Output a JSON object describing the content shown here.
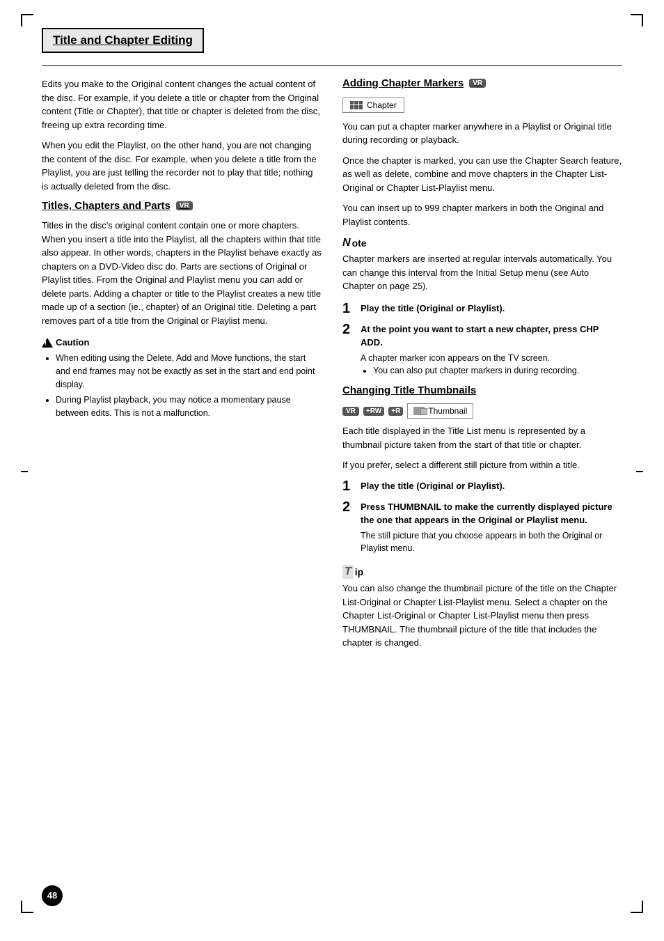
{
  "page": {
    "title": "Title and Chapter Editing",
    "page_number": "48"
  },
  "left_col": {
    "intro_text": "Edits you make to the Original content changes the actual content of the disc. For example, if you delete a title or chapter from the Original content (Title or Chapter), that title or chapter is deleted from the disc, freeing up extra recording time.",
    "intro_text2": "When you edit the Playlist, on the other hand, you are not changing the content of the disc. For example, when you delete a title from the Playlist, you are just telling the recorder not to play that title; nothing is actually deleted from the disc.",
    "section1": {
      "heading": "Titles, Chapters and Parts",
      "badge": "VR",
      "body": "Titles in the disc's original content contain one or more chapters. When you insert a title into the Playlist, all the chapters within that title also appear. In other words, chapters in the Playlist behave exactly as chapters on a DVD-Video disc do. Parts are sections of Original or Playlist titles. From the Original and Playlist menu you can add or delete parts. Adding a chapter or title to the Playlist creates a new title made up of a section (ie., chapter) of an Original title. Deleting a part removes part of a title from the Original or Playlist menu."
    },
    "caution": {
      "heading": "Caution",
      "items": [
        "When editing using the Delete, Add and Move functions, the start and end frames may not be exactly as set in the start and end point display.",
        "During Playlist playback, you may notice a momentary pause between edits. This is not a malfunction."
      ]
    }
  },
  "right_col": {
    "section2": {
      "heading": "Adding Chapter Markers",
      "badge": "VR",
      "chapter_label": "Chapter",
      "body1": "You can put a chapter marker anywhere in a Playlist or Original title during recording or playback.",
      "body2": "Once the chapter is marked, you can use the Chapter Search feature, as well as delete, combine and move chapters in the Chapter List-Original or Chapter List-Playlist menu.",
      "body3": "You can insert up to 999 chapter markers in both the Original and Playlist contents.",
      "note": {
        "heading": "ote",
        "body": "Chapter markers are inserted at regular intervals automatically. You can change this interval from the Initial Setup menu (see Auto Chapter on page 25)."
      },
      "step1": {
        "number": "1",
        "text": "Play the title (Original or Playlist)."
      },
      "step2": {
        "number": "2",
        "text": "At the point you want to start a new chapter, press CHP ADD.",
        "sub_text": "A chapter marker icon appears on the TV screen.",
        "bullet": "You can also put chapter markers in during recording."
      }
    },
    "section3": {
      "heading": "Changing Title Thumbnails",
      "badges": [
        "VR",
        "+RW",
        "+R"
      ],
      "thumbnail_label": "Thumbnail",
      "body1": "Each title displayed in the Title List menu is represented by a thumbnail picture taken from the start of that title or chapter.",
      "body2": "If you prefer, select a different still picture from within a title.",
      "step1": {
        "number": "1",
        "text": "Play the title (Original or Playlist)."
      },
      "step2": {
        "number": "2",
        "text": "Press THUMBNAIL to make the currently displayed picture the one that appears in the Original or Playlist menu.",
        "sub_text": "The still picture that you choose appears in both the Original or Playlist menu."
      },
      "tip": {
        "heading": "ip",
        "body": "You can also change the thumbnail picture of the title on the Chapter List-Original or Chapter List-Playlist menu. Select a chapter on the Chapter List-Original or Chapter List-Playlist menu then press THUMBNAIL. The thumbnail picture of the title that includes the chapter is changed."
      }
    }
  }
}
